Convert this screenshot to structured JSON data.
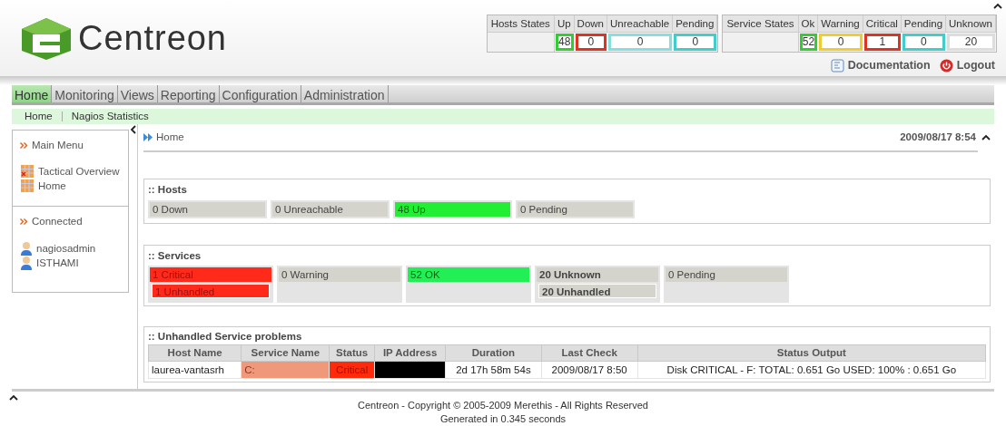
{
  "logo": {
    "text": "Centreon"
  },
  "host_states": {
    "title": "Hosts States",
    "columns": [
      {
        "label": "Up",
        "value": "48",
        "color": "#33cc33"
      },
      {
        "label": "Down",
        "value": "0",
        "color": "#dd3322"
      },
      {
        "label": "Unreachable",
        "value": "0",
        "color": "#88dddd"
      },
      {
        "label": "Pending",
        "value": "0",
        "color": "#44cccc"
      }
    ]
  },
  "service_states": {
    "title": "Service States",
    "columns": [
      {
        "label": "Ok",
        "value": "52",
        "color": "#33cc33"
      },
      {
        "label": "Warning",
        "value": "0",
        "color": "#eecc33"
      },
      {
        "label": "Critical",
        "value": "1",
        "color": "#dd3322"
      },
      {
        "label": "Pending",
        "value": "0",
        "color": "#44cccc"
      },
      {
        "label": "Unknown",
        "value": "20",
        "color": "#dddddd"
      }
    ]
  },
  "links": [
    {
      "label": "Documentation",
      "kind": "doc"
    },
    {
      "label": "Logout",
      "kind": "logout"
    }
  ],
  "menu": [
    {
      "label": "Home",
      "selected": true
    },
    {
      "label": "Monitoring",
      "selected": false
    },
    {
      "label": "Views",
      "selected": false
    },
    {
      "label": "Reporting",
      "selected": false
    },
    {
      "label": "Configuration",
      "selected": false
    },
    {
      "label": "Administration",
      "selected": false
    }
  ],
  "submenu": [
    "Home",
    "Nagios Statistics"
  ],
  "sidebar": [
    {
      "title": "Main Menu",
      "items": [
        {
          "label": "Tactical Overview",
          "kind": "tactical"
        },
        {
          "label": "Home",
          "kind": "grid"
        }
      ]
    },
    {
      "title": "Connected",
      "items": [
        {
          "label": "nagiosadmin",
          "kind": "user"
        },
        {
          "label": "ISTHAMI",
          "kind": "user"
        }
      ]
    }
  ],
  "breadcrumb": "Home",
  "datetime": "2009/08/17 8:54",
  "hosts": {
    "title": ":: Hosts",
    "items": [
      {
        "label": "0 Down",
        "color": "#d4d4cc",
        "kind": "plain"
      },
      {
        "label": "0 Unreachable",
        "color": "#d4d4cc",
        "kind": "plain"
      },
      {
        "label": "48 Up",
        "color": "#22ee33",
        "kind": "ok"
      },
      {
        "label": "0 Pending",
        "color": "#d4d4cc",
        "kind": "plain"
      }
    ]
  },
  "services": {
    "title": ":: Services",
    "items": [
      {
        "label": "1 Critical",
        "color": "#ff2a1a",
        "kind": "critical",
        "unhandled": "1 Unhandled"
      },
      {
        "label": "0 Warning",
        "color": "#d4d4cc",
        "kind": "plain"
      },
      {
        "label": "52 OK",
        "color": "#22ee55",
        "kind": "ok"
      },
      {
        "label": "20 Unknown",
        "color": "#d4d4cc",
        "kind": "bold",
        "unhandled": "20 Unhandled"
      },
      {
        "label": "0 Pending",
        "color": "#d4d4cc",
        "kind": "plain"
      }
    ]
  },
  "problems": {
    "title": ":: Unhandled Service problems",
    "columns": [
      "Host Name",
      "Service Name",
      "Status",
      "IP Address",
      "Duration",
      "Last Check",
      "Status Output"
    ],
    "rows": [
      [
        {
          "text": "laurea-vantasrh",
          "kind": "plain"
        },
        {
          "text": "C:",
          "kind": "service"
        },
        {
          "text": "Critical",
          "kind": "critical"
        },
        {
          "kind": "redacted"
        },
        {
          "text": "2d 17h 58m 54s",
          "kind": "plain"
        },
        {
          "text": "2009/08/17 8:50",
          "kind": "plain"
        },
        {
          "text": "Disk CRITICAL - F: TOTAL: 0.651 Go USED: 100% : 0.651 Go",
          "kind": "plain"
        }
      ]
    ]
  },
  "footer": [
    "Centreon - Copyright © 2005-2009 Merethis - All Rights Reserved",
    "Generated in 0.345 seconds"
  ]
}
